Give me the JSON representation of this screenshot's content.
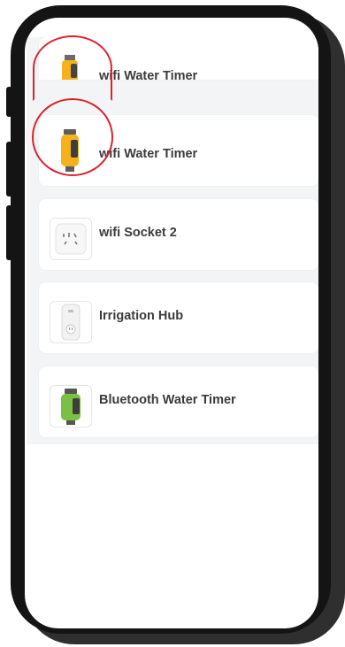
{
  "devices": [
    {
      "label": "wifi Water Timer",
      "icon": "yellow-water-timer-icon"
    },
    {
      "label": "wifi Water Timer",
      "icon": "yellow-water-timer-icon"
    },
    {
      "label": "wifi Socket 2",
      "icon": "smart-socket-icon"
    },
    {
      "label": "Irrigation Hub",
      "icon": "irrigation-hub-icon"
    },
    {
      "label": "Bluetooth Water Timer",
      "icon": "green-water-timer-icon"
    }
  ],
  "colors": {
    "highlight_circle": "#d9242f",
    "timer_yellow": "#f5b21c",
    "timer_green": "#7ac043",
    "list_background": "#f3f4f6"
  }
}
